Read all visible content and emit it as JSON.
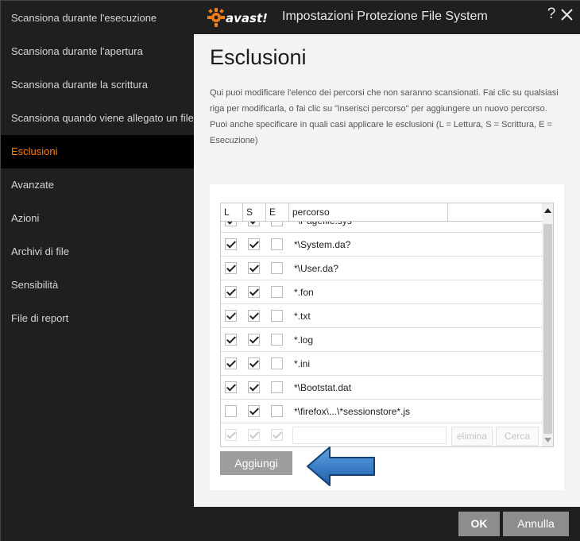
{
  "sidebar": {
    "items": [
      {
        "label": "Scansiona durante l'esecuzione"
      },
      {
        "label": "Scansiona durante l'apertura"
      },
      {
        "label": "Scansiona durante la scrittura"
      },
      {
        "label": "Scansiona quando viene allegato un file"
      },
      {
        "label": "Esclusioni",
        "active": true
      },
      {
        "label": "Avanzate"
      },
      {
        "label": "Azioni"
      },
      {
        "label": "Archivi di file"
      },
      {
        "label": "Sensibilità"
      },
      {
        "label": "File di report"
      }
    ]
  },
  "titlebar": {
    "logo_text": "avast!",
    "title": "Impostazioni Protezione File System",
    "help": "?",
    "brand_color": "#f07e1a"
  },
  "main": {
    "heading": "Esclusioni",
    "description_1": "Qui puoi modificare l'elenco dei percorsi che non saranno scansionati. Fai clic su qualsiasi riga per modificarla, o fai clic su \"inserisci percorso\" per aggiungere un nuovo percorso.",
    "description_2": "Puoi anche specificare in quali casi applicare le esclusioni (L = Lettura, S = Scrittura, E = Esecuzione)"
  },
  "table": {
    "headers": {
      "l": "L",
      "s": "S",
      "e": "E",
      "path": "percorso"
    },
    "partial_row": {
      "path": "*\\Pagefile.sys",
      "l": true,
      "s": true,
      "e": false
    },
    "rows": [
      {
        "path": "*\\System.da?",
        "l": true,
        "s": true,
        "e": false
      },
      {
        "path": "*\\User.da?",
        "l": true,
        "s": true,
        "e": false
      },
      {
        "path": "*.fon",
        "l": true,
        "s": true,
        "e": false
      },
      {
        "path": "*.txt",
        "l": true,
        "s": true,
        "e": false
      },
      {
        "path": "*.log",
        "l": true,
        "s": true,
        "e": false
      },
      {
        "path": "*.ini",
        "l": true,
        "s": true,
        "e": false
      },
      {
        "path": "*\\Bootstat.dat",
        "l": true,
        "s": true,
        "e": false
      },
      {
        "path": "*\\firefox\\...\\*sessionstore*.js",
        "l": false,
        "s": true,
        "e": false
      }
    ],
    "new_row": {
      "path_value": "",
      "delete_label": "elimina",
      "search_label": "Cerca"
    }
  },
  "add_button": "Aggiungi",
  "footer": {
    "ok": "OK",
    "cancel": "Annulla"
  },
  "colors": {
    "accent": "#ff7f00",
    "arrow": "#2b6fb5"
  }
}
